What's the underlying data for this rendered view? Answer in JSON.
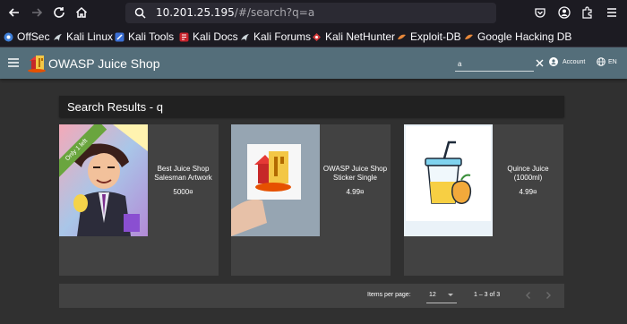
{
  "browser": {
    "url_host": "10.201.25.195",
    "url_path": "/#/search?q=a"
  },
  "bookmarks": [
    {
      "label": "OffSec",
      "icon": "offsec-icon"
    },
    {
      "label": "Kali Linux",
      "icon": "kali-dragon-icon"
    },
    {
      "label": "Kali Tools",
      "icon": "kali-tools-icon"
    },
    {
      "label": "Kali Docs",
      "icon": "kali-docs-icon"
    },
    {
      "label": "Kali Forums",
      "icon": "kali-dragon-icon"
    },
    {
      "label": "Kali NetHunter",
      "icon": "nethunter-icon"
    },
    {
      "label": "Exploit-DB",
      "icon": "exploit-db-icon"
    },
    {
      "label": "Google Hacking DB",
      "icon": "ghdb-icon"
    }
  ],
  "app": {
    "title": "OWASP Juice Shop",
    "search_value": "a",
    "account_label": "Account",
    "language_label": "EN"
  },
  "results": {
    "title": "Search Results - q"
  },
  "products": [
    {
      "name": "Best Juice Shop Salesman Artwork",
      "price": "5000¤",
      "ribbon": "Only 1 left"
    },
    {
      "name": "OWASP Juice Shop Sticker Single",
      "price": "4.99¤"
    },
    {
      "name": "Quince Juice (1000ml)",
      "price": "4.99¤"
    }
  ],
  "paginator": {
    "items_per_page_label": "Items per page:",
    "page_size": "12",
    "range_label": "1 – 3 of 3"
  },
  "colors": {
    "toolbar": "#546e7a",
    "card": "#424242",
    "background": "#303030",
    "ribbon": "#6aa53e"
  }
}
